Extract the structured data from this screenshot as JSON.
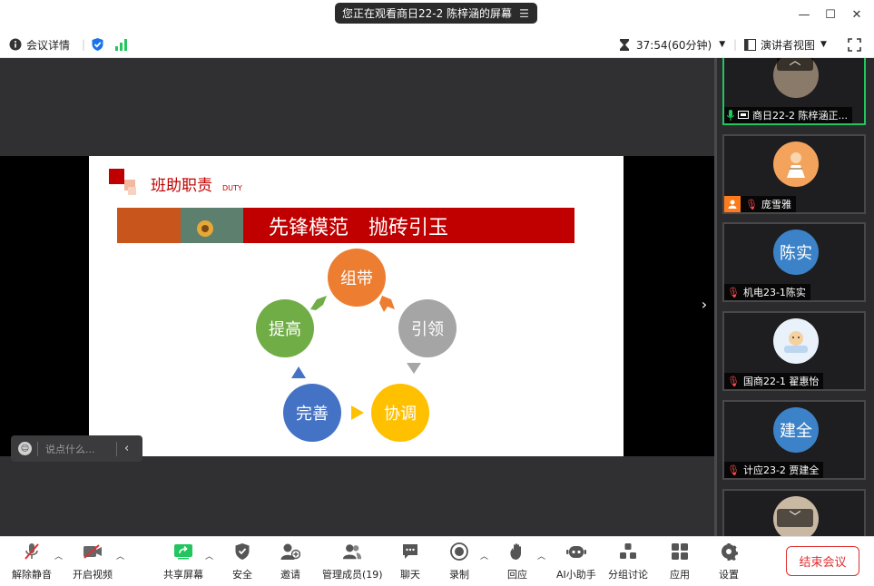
{
  "titlebar": {
    "share_notice": "您正在观看商日22-2 陈梓涵的屏幕",
    "minimize_icon": "minimize-icon",
    "maximize_icon": "maximize-icon",
    "close_icon": "close-icon"
  },
  "infobar": {
    "meeting_info_label": "会议详情",
    "timer": "37:54(60分钟)",
    "view_mode": "演讲者视图"
  },
  "slide": {
    "header_title": "班助职责",
    "header_sub": "DUTY",
    "banner_text": "先锋模范　抛砖引玉",
    "cycle": [
      {
        "label": "组带",
        "color": "#ED7D31"
      },
      {
        "label": "引领",
        "color": "#A5A5A5"
      },
      {
        "label": "协调",
        "color": "#FFC000"
      },
      {
        "label": "完善",
        "color": "#4472C4"
      },
      {
        "label": "提高",
        "color": "#70AD47"
      }
    ]
  },
  "chat": {
    "placeholder": "说点什么..."
  },
  "participants": [
    {
      "name": "商日22-2 陈梓涵正...",
      "avatar_text": "",
      "active": true
    },
    {
      "name": "庞雪雅",
      "avatar_text": ""
    },
    {
      "name": "机电23-1陈实",
      "avatar_text": "陈实",
      "avatar_color": "#3b82c8"
    },
    {
      "name": "国商22-1 翟惠怡",
      "avatar_text": ""
    },
    {
      "name": "计应23-2 贾建全",
      "avatar_text": "建全",
      "avatar_color": "#3b82c8"
    }
  ],
  "toolbar": {
    "unmute": "解除静音",
    "start_video": "开启视频",
    "share_screen": "共享屏幕",
    "security": "安全",
    "invite": "邀请",
    "participants": "管理成员(19)",
    "chat": "聊天",
    "record": "录制",
    "reactions": "回应",
    "ai_assistant": "AI小助手",
    "breakout": "分组讨论",
    "apps": "应用",
    "settings": "设置",
    "end_meeting": "结束会议"
  },
  "colors": {
    "accent_red": "#C00000",
    "accent_green": "#22c55e",
    "end_red": "#e02f2f",
    "panel_dark": "#303033"
  }
}
